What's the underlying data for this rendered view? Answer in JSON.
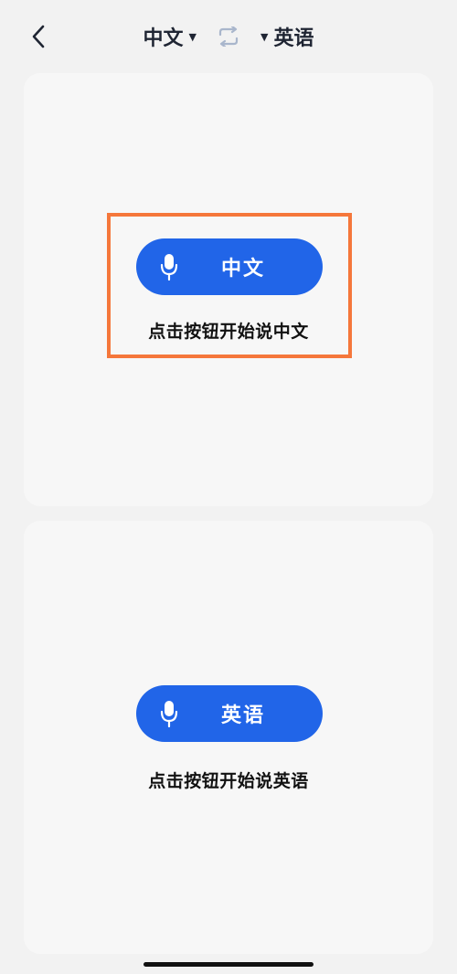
{
  "header": {
    "source_lang": "中文",
    "target_lang": "英语",
    "caret": "▼"
  },
  "top_panel": {
    "button_label": "中文",
    "hint": "点击按钮开始说中文"
  },
  "bottom_panel": {
    "button_label": "英语",
    "hint": "点击按钮开始说英语"
  },
  "colors": {
    "accent": "#2165e8",
    "highlight": "#f5773b",
    "background": "#f2f2f2"
  },
  "icons": [
    "back-arrow-icon",
    "caret-down-icon",
    "swap-icon",
    "microphone-icon"
  ]
}
